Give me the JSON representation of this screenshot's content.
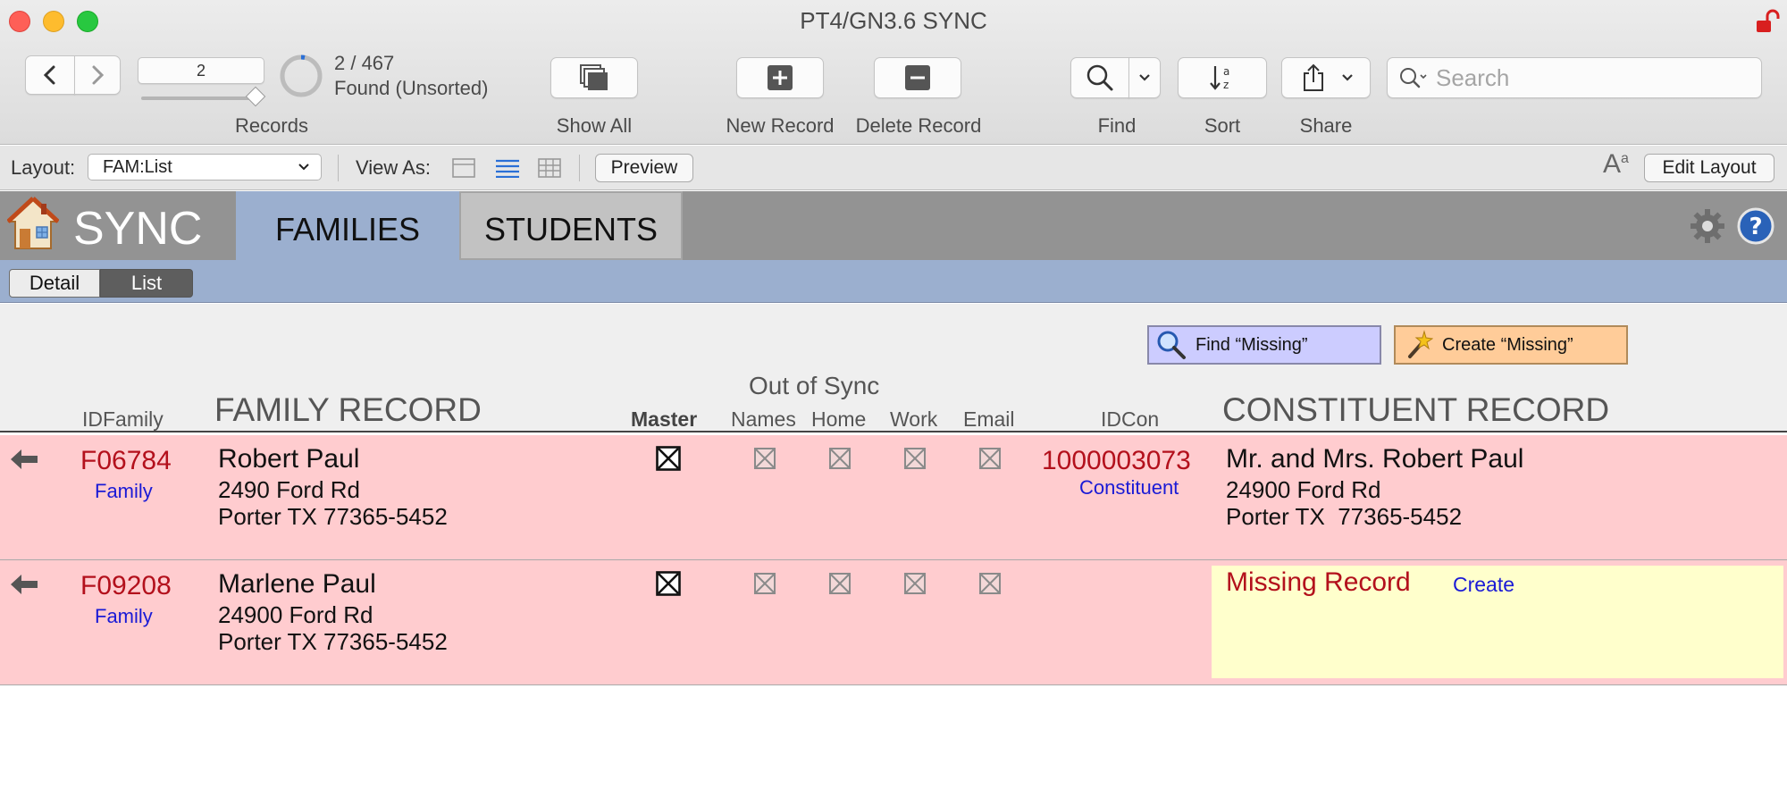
{
  "window": {
    "title": "PT4/GN3.6 SYNC"
  },
  "toolbar": {
    "record_field_value": "2",
    "record_count": "2 / 467",
    "found_status": "Found (Unsorted)",
    "records_label": "Records",
    "show_all_label": "Show All",
    "new_record_label": "New Record",
    "delete_record_label": "Delete Record",
    "find_label": "Find",
    "sort_label": "Sort",
    "share_label": "Share",
    "search_placeholder": "Search"
  },
  "layout_bar": {
    "layout_label": "Layout:",
    "layout_value": "FAM:List",
    "view_as_label": "View As:",
    "preview_label": "Preview",
    "edit_layout_label": "Edit Layout"
  },
  "header": {
    "app_name": "SYNC",
    "tabs": [
      {
        "label": "FAMILIES",
        "active": true
      },
      {
        "label": "STUDENTS",
        "active": false
      }
    ],
    "subtabs": [
      {
        "label": "Detail",
        "active": false
      },
      {
        "label": "List",
        "active": true
      }
    ]
  },
  "actions": {
    "find_missing_label": "Find “Missing”",
    "create_missing_label": "Create “Missing”"
  },
  "columns": {
    "out_of_sync": "Out of Sync",
    "id_family": "IDFamily",
    "family_record": "FAMILY RECORD",
    "master": "Master",
    "names": "Names",
    "home": "Home",
    "work": "Work",
    "email": "Email",
    "id_con": "IDCon",
    "constituent_record": "CONSTITUENT RECORD"
  },
  "rows": [
    {
      "id_family": "F06784",
      "family_link": "Family",
      "family_name": "Robert Paul",
      "family_addr1": "2490 Ford Rd",
      "family_addr2": "Porter TX 77365-5452",
      "master_checked": true,
      "id_con": "1000003073",
      "constituent_link": "Constituent",
      "con_name": "Mr. and Mrs. Robert Paul",
      "con_addr1": "24900 Ford Rd",
      "con_addr2": "Porter TX  77365-5452"
    },
    {
      "id_family": "F09208",
      "family_link": "Family",
      "family_name": "Marlene Paul",
      "family_addr1": "24900 Ford Rd",
      "family_addr2": "Porter TX 77365-5452",
      "master_checked": true,
      "missing_label": "Missing Record",
      "create_label": "Create"
    }
  ],
  "colors": {
    "row_bg": "#ffcccf",
    "missing_bg": "#ffffcc",
    "id_red": "#b3101c",
    "link_blue": "#1a1ad6",
    "header_gray": "#939393",
    "tab_blue": "#9bafcf",
    "find_btn": "#ccccff",
    "create_btn": "#ffcc99"
  },
  "icons": [
    "back-arrow-icon",
    "forward-arrow-icon",
    "show-all-icon",
    "plus-icon",
    "minus-icon",
    "magnifier-icon",
    "sort-az-icon",
    "share-icon",
    "gear-icon",
    "help-icon",
    "house-icon",
    "lock-icon",
    "wand-icon",
    "row-arrow-icon"
  ]
}
